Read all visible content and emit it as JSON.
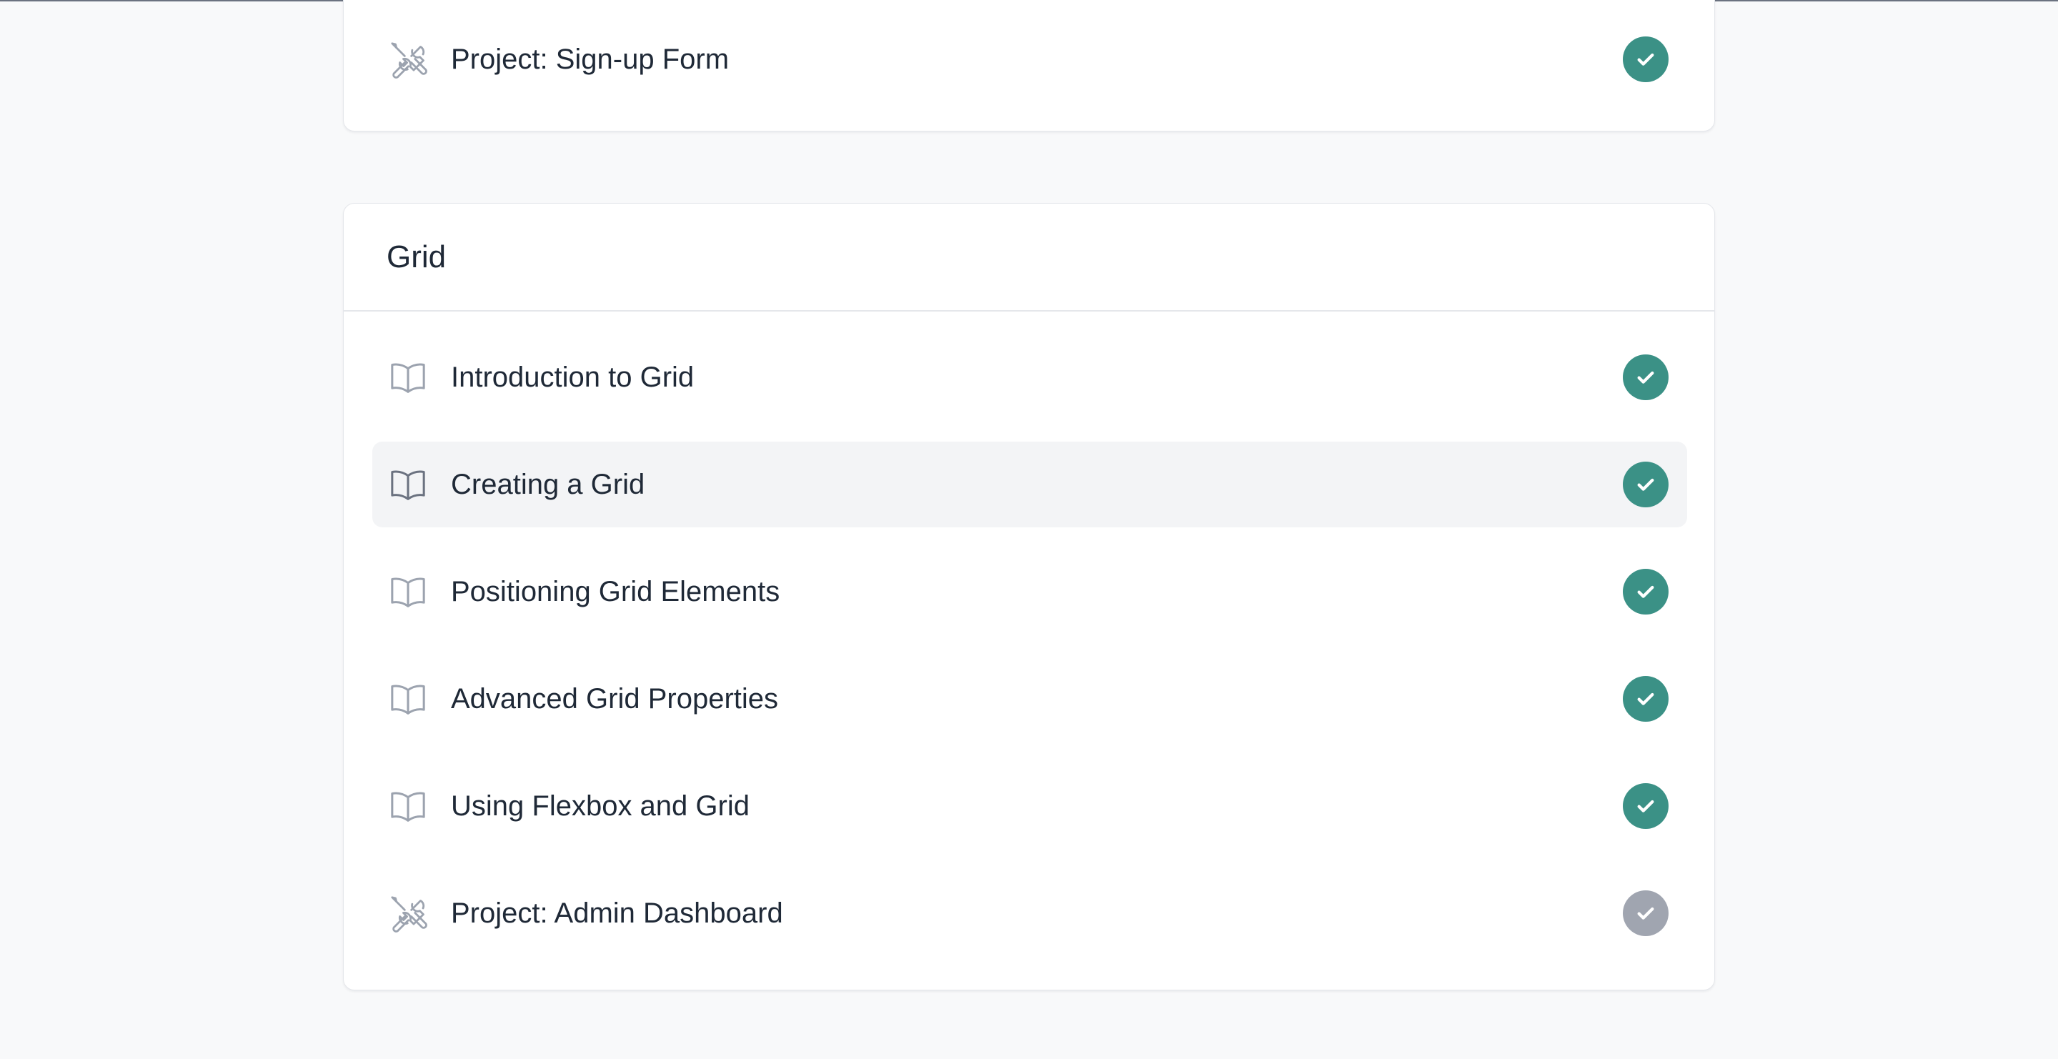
{
  "top_section": {
    "item": {
      "title": "Project: Sign-up Form",
      "type_icon": "tools-icon",
      "status": "complete",
      "status_icon": "checkmark-icon"
    }
  },
  "grid_section": {
    "title": "Grid",
    "items": [
      {
        "title": "Introduction to Grid",
        "type_icon": "book-icon",
        "status": "complete",
        "status_icon": "checkmark-icon"
      },
      {
        "title": "Creating a Grid",
        "type_icon": "book-icon",
        "status": "complete",
        "status_icon": "checkmark-icon"
      },
      {
        "title": "Positioning Grid Elements",
        "type_icon": "book-icon",
        "status": "complete",
        "status_icon": "checkmark-icon"
      },
      {
        "title": "Advanced Grid Properties",
        "type_icon": "book-icon",
        "status": "complete",
        "status_icon": "checkmark-icon"
      },
      {
        "title": "Using Flexbox and Grid",
        "type_icon": "book-icon",
        "status": "complete",
        "status_icon": "checkmark-icon"
      },
      {
        "title": "Project: Admin Dashboard",
        "type_icon": "tools-icon",
        "status": "incomplete",
        "status_icon": "checkmark-icon"
      }
    ]
  },
  "colors": {
    "complete": "#3b9186",
    "incomplete": "#a0a5b0",
    "highlight_row": "#f3f4f6",
    "page_background": "#f8f9fa",
    "text": "#1f2937",
    "icon": "#9ca3af"
  }
}
